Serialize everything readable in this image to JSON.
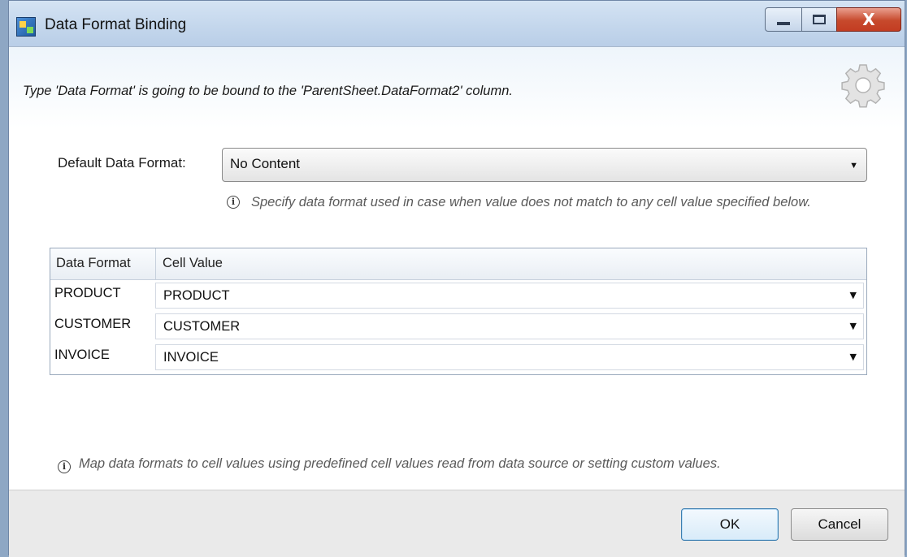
{
  "window": {
    "title": "Data Format Binding",
    "controls": {
      "minimize": "minimize",
      "maximize": "maximize",
      "close": "X"
    }
  },
  "header": {
    "description": "Type 'Data Format' is going to be bound to the 'ParentSheet.DataFormat2' column.",
    "icon": "gear-icon"
  },
  "default_format": {
    "label": "Default Data Format:",
    "value": "No Content",
    "hint": "Specify data format used in case when value does not match to any cell value specified below."
  },
  "grid": {
    "columns": [
      "Data Format",
      "Cell Value"
    ],
    "rows": [
      {
        "format": "PRODUCT",
        "value": "PRODUCT"
      },
      {
        "format": "CUSTOMER",
        "value": "CUSTOMER"
      },
      {
        "format": "INVOICE",
        "value": "INVOICE"
      }
    ]
  },
  "footer": {
    "hint": "Map data formats to cell values using predefined cell values read from data source or setting custom values."
  },
  "buttons": {
    "ok": "OK",
    "cancel": "Cancel"
  }
}
